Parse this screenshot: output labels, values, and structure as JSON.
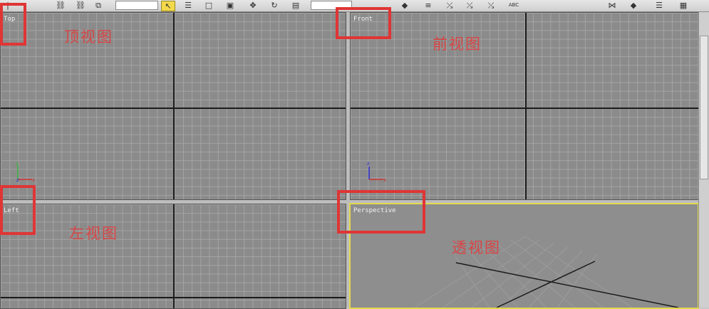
{
  "toolbar": {
    "icons": [
      {
        "name": "select-object-icon",
        "glyph": "↖"
      },
      {
        "name": "select-by-name-icon",
        "glyph": "☰"
      },
      {
        "name": "rect-select-icon",
        "glyph": "□"
      },
      {
        "name": "window-crossing-icon",
        "glyph": "▣"
      },
      {
        "name": "move-icon",
        "glyph": "✥"
      },
      {
        "name": "rotate-icon",
        "glyph": "↻"
      },
      {
        "name": "scale-icon",
        "glyph": "▤"
      },
      {
        "name": "mirror-icon",
        "glyph": "◆"
      },
      {
        "name": "align-icon",
        "glyph": "≡"
      },
      {
        "name": "spell-check-icon",
        "glyph": "ABC"
      },
      {
        "name": "render-icon",
        "glyph": "▦"
      }
    ]
  },
  "viewports": {
    "top": {
      "label": "Top",
      "annotation": "顶视图"
    },
    "front": {
      "label": "Front",
      "annotation": "前视图"
    },
    "left": {
      "label": "Left",
      "annotation": "左视图"
    },
    "perspective": {
      "label": "Perspective",
      "annotation": "透视图"
    }
  },
  "axes": {
    "x": "x",
    "y": "y",
    "z": "z"
  },
  "colors": {
    "viewport_bg": "#8b8b8b",
    "grid_line": "#a4a4a4",
    "major_line": "#1b1b1b",
    "active_border": "#e3d84d",
    "annotation_red": "#e03535"
  }
}
